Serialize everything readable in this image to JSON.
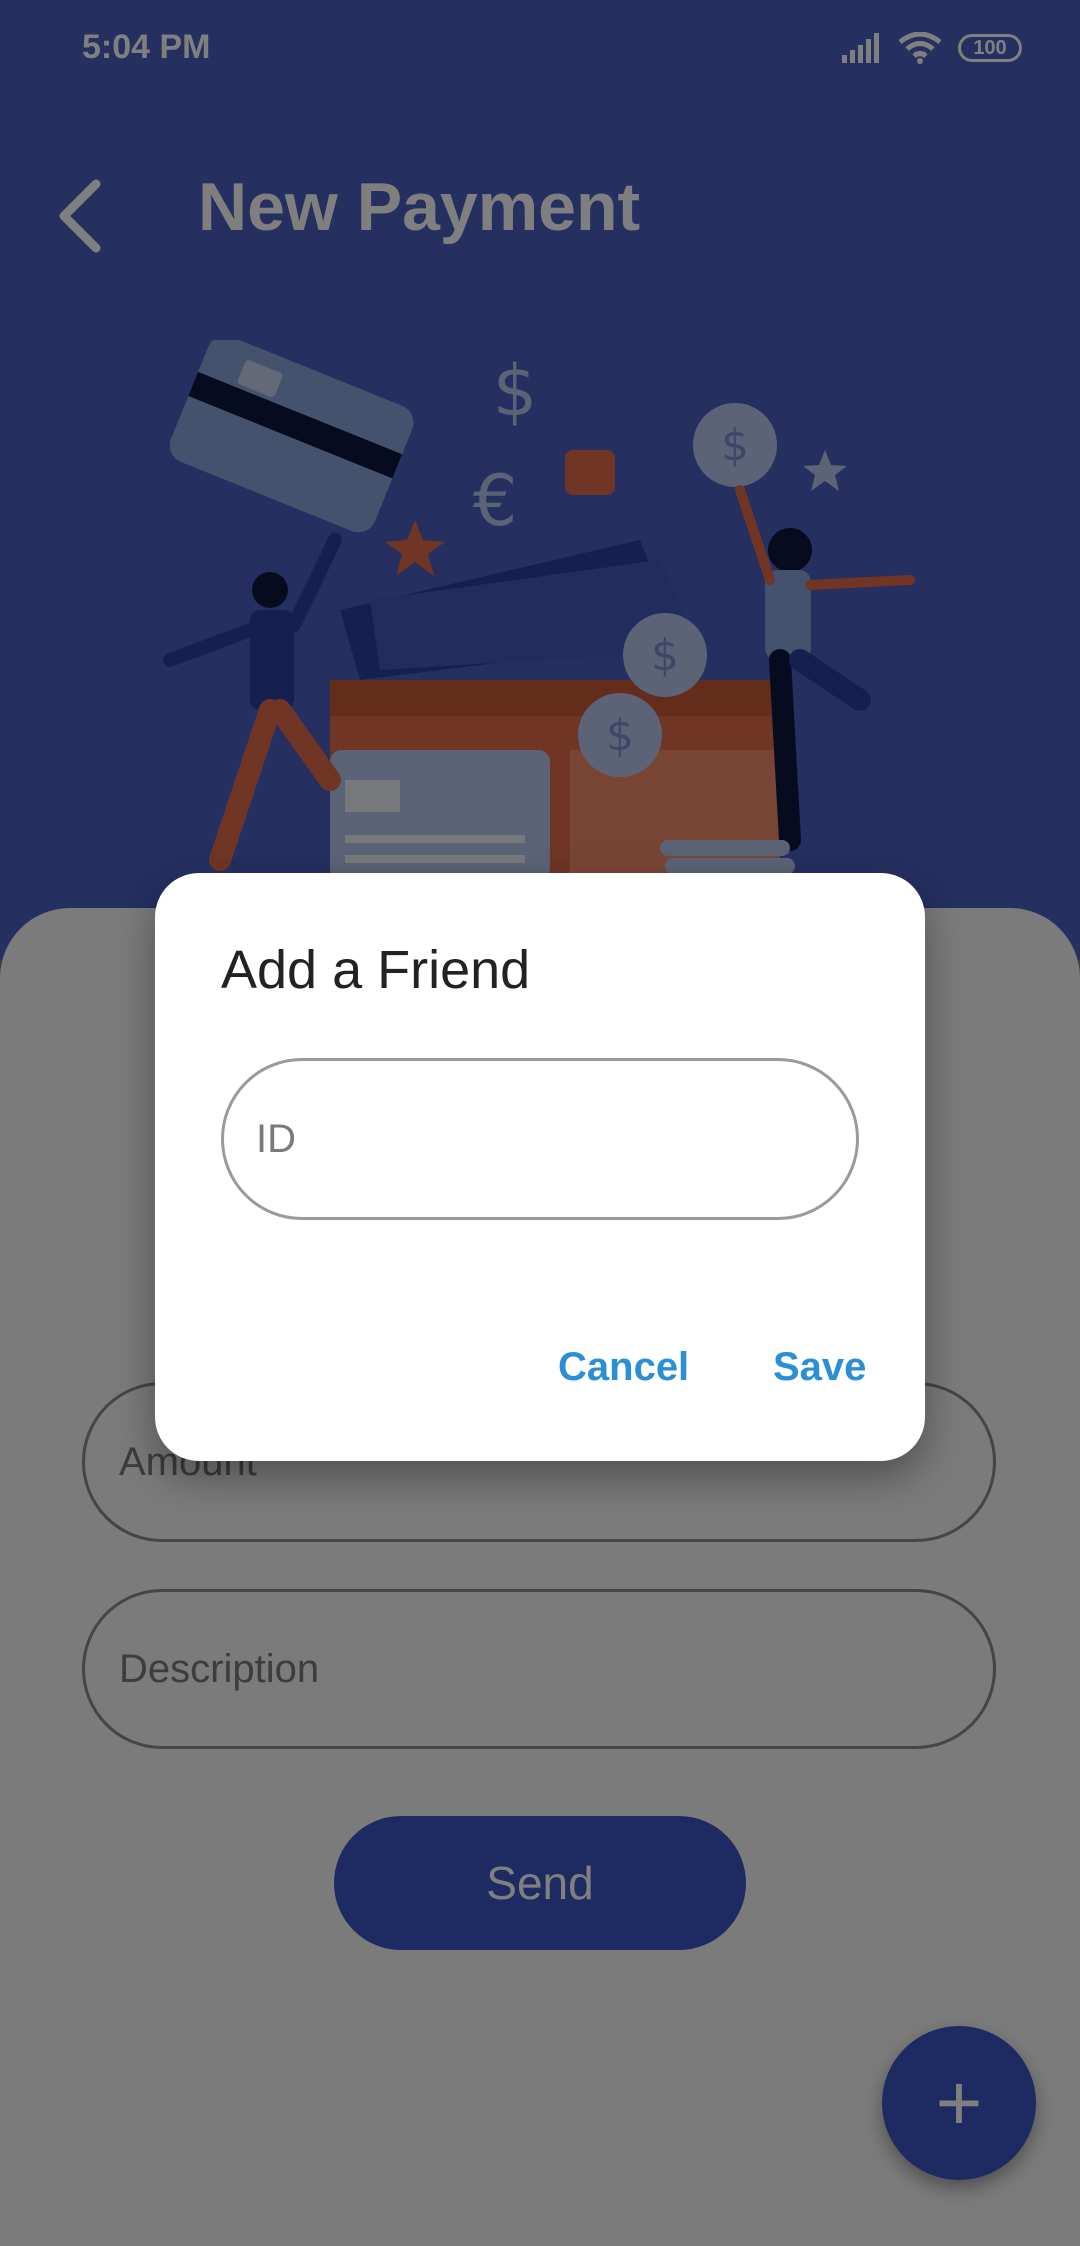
{
  "status_bar": {
    "time": "5:04 PM",
    "battery": "100",
    "icons": [
      "signal-icon",
      "wifi-icon",
      "battery-icon"
    ]
  },
  "appbar": {
    "title": "New Payment",
    "back_icon": "chevron-left-icon"
  },
  "form": {
    "amount_placeholder": "Amount",
    "description_placeholder": "Description",
    "send_label": "Send"
  },
  "fab": {
    "label": "+",
    "icon": "plus-icon"
  },
  "dialog": {
    "title": "Add a Friend",
    "id_placeholder": "ID",
    "cancel_label": "Cancel",
    "save_label": "Save"
  },
  "colors": {
    "primary": "#3c56c4",
    "accent_text": "#2b8fd6",
    "hero_bg": "#4a5fc1",
    "sheet_bg": "#f6f6f8"
  }
}
